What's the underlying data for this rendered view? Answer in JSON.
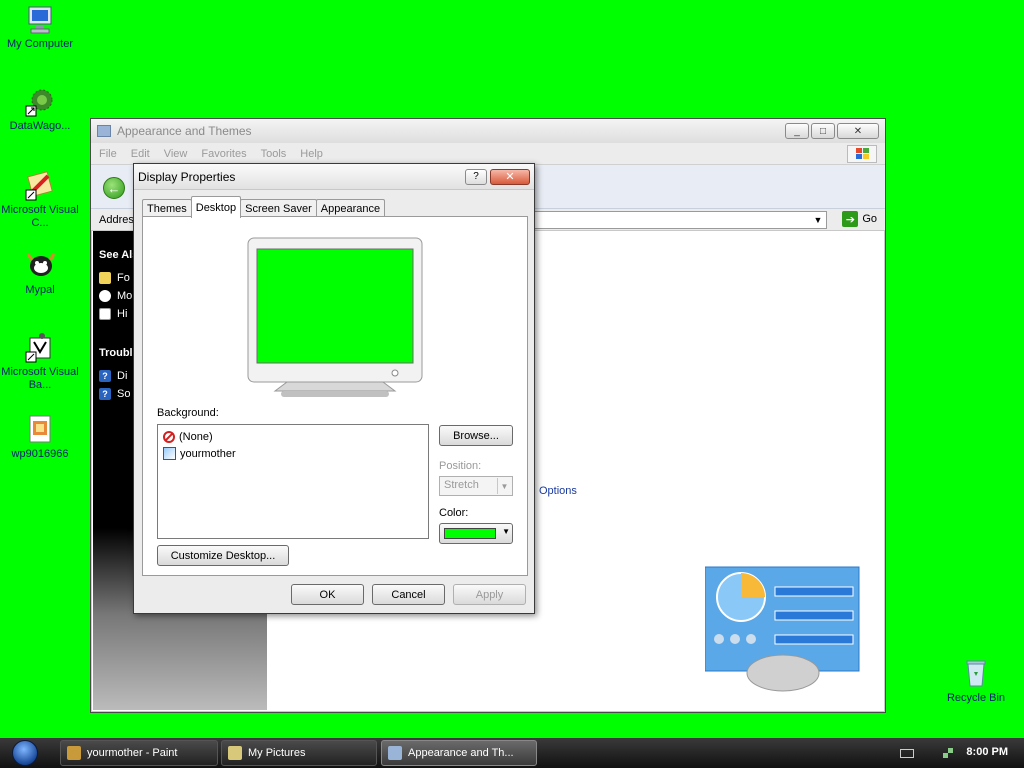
{
  "colors": {
    "desktop_bg": "#00ff00",
    "taskbar_bg": "#1a1a1a",
    "link": "#1a3aa0"
  },
  "desktop_icons": [
    {
      "label": "My Computer",
      "icon": "computer-icon"
    },
    {
      "label": "DataWago...",
      "icon": "datawagon-icon"
    },
    {
      "label": "Microsoft Visual C...",
      "icon": "visual-c-icon"
    },
    {
      "label": "Mypal",
      "icon": "mypal-icon"
    },
    {
      "label": "Microsoft Visual Ba...",
      "icon": "visual-basic-icon"
    },
    {
      "label": "wp9016966",
      "icon": "image-file-icon"
    },
    {
      "label": "Recycle Bin",
      "icon": "recycle-bin-icon"
    }
  ],
  "explorer": {
    "title": "Appearance and Themes",
    "menu": [
      "File",
      "Edit",
      "View",
      "Favorites",
      "Tools",
      "Help"
    ],
    "address_label": "Addres",
    "go_label": "Go",
    "left_pane": {
      "see_also_head": "See Als",
      "see_also_items": [
        "Fo",
        "Mo",
        "Hi"
      ],
      "troubleshoot_head": "Troubl",
      "troubleshoot_items": [
        "Di",
        "So"
      ]
    },
    "options_link": "Options"
  },
  "dialog": {
    "title": "Display Properties",
    "help_btn": "?",
    "close_btn": "✕",
    "tabs": [
      "Themes",
      "Desktop",
      "Screen Saver",
      "Appearance"
    ],
    "active_tab": "Desktop",
    "background_label": "Background:",
    "background_items": [
      "(None)",
      "yourmother"
    ],
    "browse_btn": "Browse...",
    "position_label": "Position:",
    "position_value": "Stretch",
    "color_label": "Color:",
    "color_value": "#00ff00",
    "customize_btn": "Customize Desktop...",
    "ok_btn": "OK",
    "cancel_btn": "Cancel",
    "apply_btn": "Apply"
  },
  "taskbar": {
    "items": [
      "yourmother - Paint",
      "My Pictures",
      "Appearance and Th..."
    ],
    "active_index": 2,
    "clock": "8:00 PM"
  }
}
